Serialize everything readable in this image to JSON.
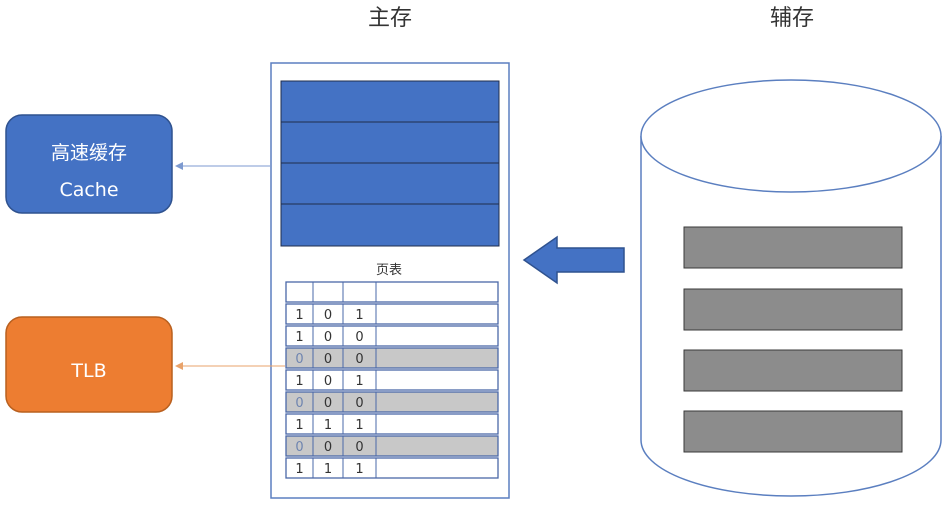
{
  "main_memory": {
    "title": "主存"
  },
  "secondary_storage": {
    "title": "辅存"
  },
  "cache_box": {
    "line1": "高速缓存",
    "line2": "Cache"
  },
  "tlb_box": {
    "label": "TLB"
  },
  "page_table": {
    "title": "页表",
    "rows": [
      {
        "cells": [
          "1",
          "0",
          "1"
        ],
        "shaded": false
      },
      {
        "cells": [
          "1",
          "0",
          "0"
        ],
        "shaded": false
      },
      {
        "cells": [
          "0",
          "0",
          "0"
        ],
        "shaded": true
      },
      {
        "cells": [
          "1",
          "0",
          "1"
        ],
        "shaded": false
      },
      {
        "cells": [
          "0",
          "0",
          "0"
        ],
        "shaded": true
      },
      {
        "cells": [
          "1",
          "1",
          "1"
        ],
        "shaded": false
      },
      {
        "cells": [
          "0",
          "0",
          "0"
        ],
        "shaded": true
      },
      {
        "cells": [
          "1",
          "1",
          "1"
        ],
        "shaded": false
      }
    ]
  },
  "colors": {
    "cache": "#4472c4",
    "tlb": "#ed7d31",
    "memory_blocks": "#4472c4",
    "disk_blocks": "#8c8c8c",
    "shaded_row": "#c8c8c8",
    "outline": "#5b7fc0"
  }
}
